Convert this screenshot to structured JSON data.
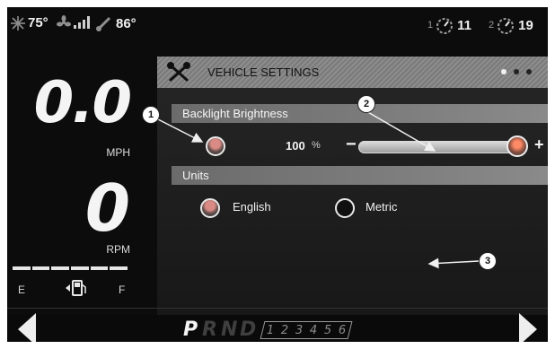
{
  "status": {
    "temp": "75°",
    "coolant": "86°",
    "t1_sub": "1",
    "t1_val": "11",
    "t2_sub": "2",
    "t2_val": "19",
    "icons": [
      "snowflake-icon",
      "fan-icon",
      "signal-icon",
      "thermometer-icon",
      "timer-icon"
    ]
  },
  "gauge": {
    "speed": "0.0",
    "speed_unit": "MPH",
    "rpm": "0",
    "rpm_unit": "RPM",
    "fuel_e": "E",
    "fuel_f": "F"
  },
  "settings": {
    "title": "VEHICLE SETTINGS",
    "backlight_label": "Backlight Brightness",
    "backlight_value": "100",
    "backlight_unit": "%",
    "minus": "−",
    "plus": "+",
    "units_label": "Units",
    "unit_options": [
      "English",
      "Metric"
    ],
    "selected_unit": "English"
  },
  "gear": {
    "letters": [
      "P",
      "R",
      "N",
      "D"
    ],
    "active": "P",
    "numbers": [
      "1",
      "2",
      "3",
      "4",
      "5",
      "6"
    ]
  },
  "callouts": [
    "1",
    "2",
    "3"
  ],
  "colors": {
    "accent": "#e07a6a",
    "background": "#0c0c0c"
  }
}
